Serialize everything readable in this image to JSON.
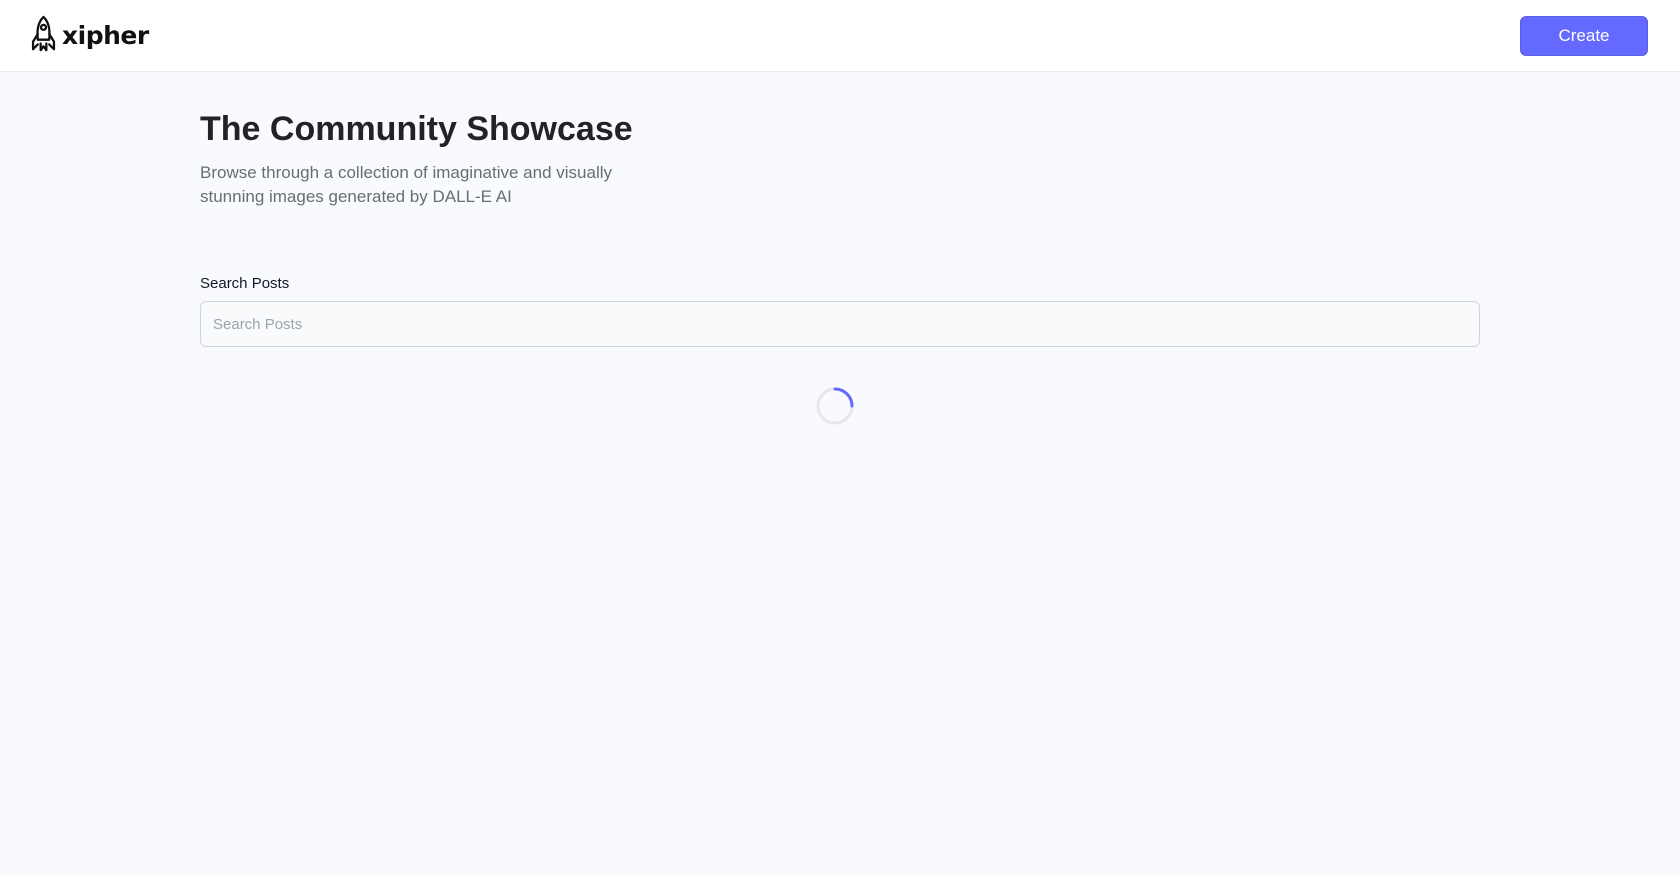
{
  "header": {
    "logo_text": "xipher",
    "create_label": "Create"
  },
  "main": {
    "title": "The Community Showcase",
    "subtitle": "Browse through a collection of imaginative and visually stunning images generated by DALL-E AI",
    "search": {
      "label": "Search Posts",
      "placeholder": "Search Posts",
      "value": ""
    }
  },
  "icons": {
    "logo": "rocket-icon",
    "loading": "loader-spinner-icon"
  },
  "colors": {
    "accent": "#6469ff",
    "background": "#f9fafe",
    "title": "#222328",
    "subtitle": "#666e75"
  }
}
